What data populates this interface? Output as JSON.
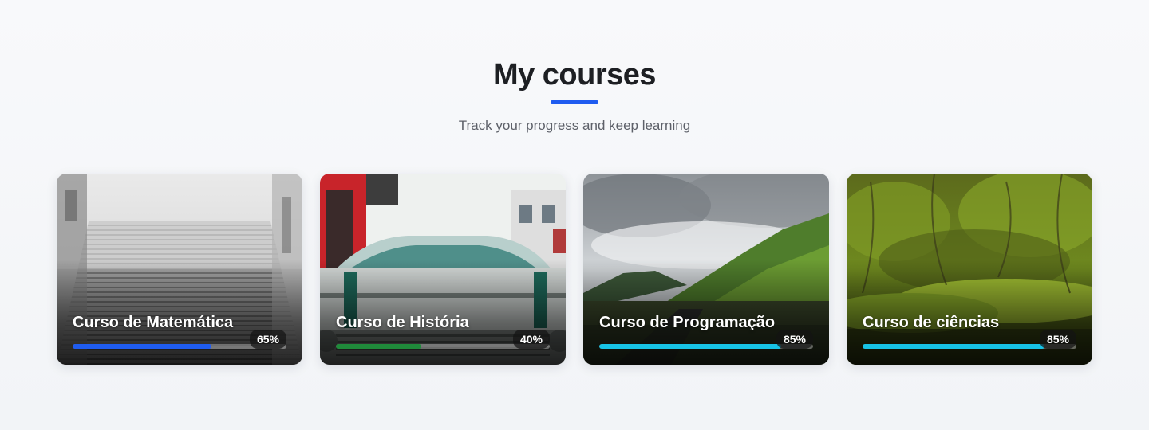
{
  "header": {
    "title": "My courses",
    "subtitle": "Track your progress and keep learning",
    "accent_color": "#1f5cf0"
  },
  "courses": [
    {
      "title": "Curso de Matemática",
      "progress": 0.65,
      "progress_label": "65%",
      "bar_color": "#1f5cf0",
      "image": "foggy-stairway-photo"
    },
    {
      "title": "Curso de História",
      "progress": 0.4,
      "progress_label": "40%",
      "bar_color": "#1f8a3a",
      "image": "vintage-car-photo"
    },
    {
      "title": "Curso de Programação",
      "progress": 0.85,
      "progress_label": "85%",
      "bar_color": "#17c3e6",
      "image": "green-mountain-valley-photo"
    },
    {
      "title": "Curso de ciências",
      "progress": 0.85,
      "progress_label": "85%",
      "bar_color": "#17c3e6",
      "image": "mossy-forest-photo"
    }
  ]
}
